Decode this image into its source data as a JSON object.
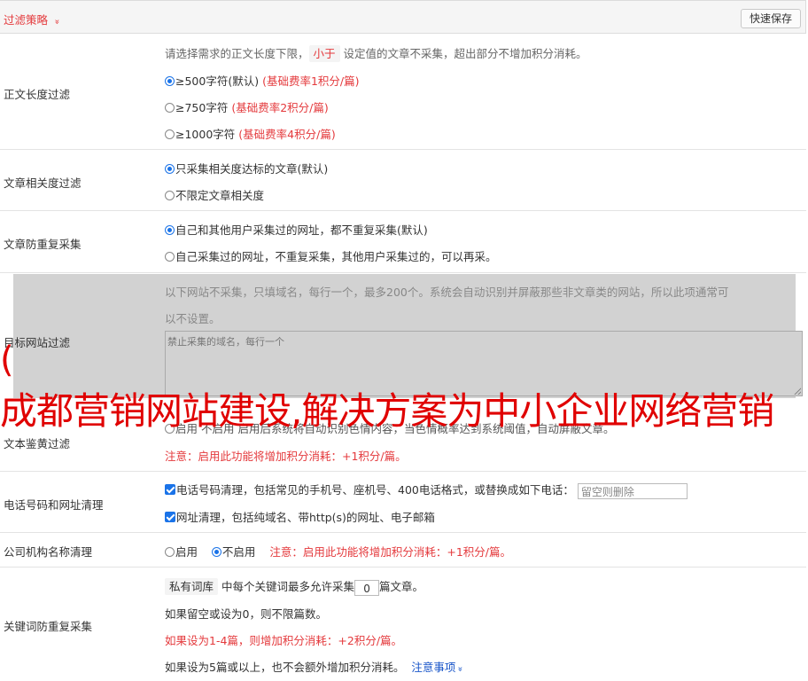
{
  "header": {
    "title": "过滤策略",
    "chevron": "»",
    "quick_save": "快速保存"
  },
  "length_filter": {
    "label": "正文长度过滤",
    "desc_pre": "请选择需求的正文长度下限，",
    "desc_tag": "小于",
    "desc_post": "设定值的文章不采集，超出部分不增加积分消耗。",
    "options": [
      {
        "text": "≥500字符(默认)",
        "note": "(基础费率1积分/篇)",
        "selected": true
      },
      {
        "text": "≥750字符",
        "note": "(基础费率2积分/篇)",
        "selected": false
      },
      {
        "text": "≥1000字符",
        "note": "(基础费率4积分/篇)",
        "selected": false
      }
    ]
  },
  "relevance_filter": {
    "label": "文章相关度过滤",
    "options": [
      {
        "text": "只采集相关度达标的文章(默认)",
        "selected": true
      },
      {
        "text": "不限定文章相关度",
        "selected": false
      }
    ]
  },
  "dup_filter": {
    "label": "文章防重复采集",
    "options": [
      {
        "text": "自己和其他用户采集过的网址，都不重复采集(默认)",
        "selected": true
      },
      {
        "text": "自己采集过的网址，不重复采集，其他用户采集过的，可以再采。",
        "selected": false
      }
    ]
  },
  "target_site": {
    "label": "目标网站过滤",
    "desc_line1": "以下网站不采集，只填域名，每行一个，最多200个。系统会自动识别并屏蔽那些非文章类的网站，所以此项通常可",
    "desc_line2": "以不设置。",
    "placeholder": "禁止采集的域名，每行一个"
  },
  "porn_filter": {
    "label": "文本鉴黄过滤",
    "line1": "启用   不启用  启用后系统将自动识别色情内容，当色情概率达到系统阈值，自动屏蔽文章。",
    "note": "注意：启用此功能将增加积分消耗：+1积分/篇。"
  },
  "phone_url": {
    "label": "电话号码和网址清理",
    "phone_text": "电话号码清理，包括常见的手机号、座机号、400电话格式，或替换成如下电话：",
    "phone_placeholder": "留空则删除",
    "url_text": "网址清理，包括纯域名、带http(s)的网址、电子邮箱"
  },
  "company": {
    "label": "公司机构名称清理",
    "enable": "启用",
    "disable": "不启用",
    "note": "注意：启用此功能将增加积分消耗：+1积分/篇。"
  },
  "keyword_dup": {
    "label": "关键词防重复采集",
    "tag": "私有词库",
    "line1_pre": "中每个关键词最多允许采集",
    "value": "0",
    "line1_post": "篇文章。",
    "line2": "如果留空或设为0，则不限篇数。",
    "line3": "如果设为1-4篇，则增加积分消耗：+2积分/篇。",
    "line4": "如果设为5篇或以上，也不会额外增加积分消耗。",
    "link": "注意事项",
    "link_chevron": "»"
  },
  "watermark": {
    "paren": "(",
    "text": "成都营销网站建设,解决方案为中小企业网络营销"
  }
}
